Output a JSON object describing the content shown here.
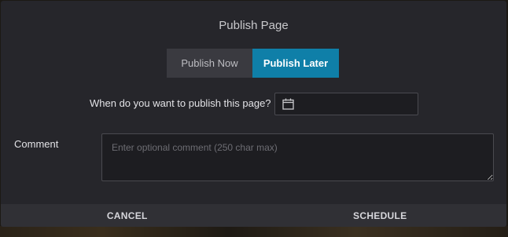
{
  "dialog": {
    "title": "Publish Page"
  },
  "publish_mode": {
    "options": [
      {
        "label": "Publish Now",
        "selected": false
      },
      {
        "label": "Publish Later",
        "selected": true
      }
    ]
  },
  "schedule": {
    "label": "When do you want to publish this page?",
    "value": "",
    "icon": "calendar-icon"
  },
  "comment": {
    "label": "Comment",
    "value": "",
    "placeholder": "Enter optional comment (250 char max)"
  },
  "footer": {
    "cancel_label": "CANCEL",
    "schedule_label": "SCHEDULE"
  },
  "colors": {
    "accent": "#0f7fa8",
    "dialog_bg": "#26262b",
    "footer_bg": "#303035"
  }
}
